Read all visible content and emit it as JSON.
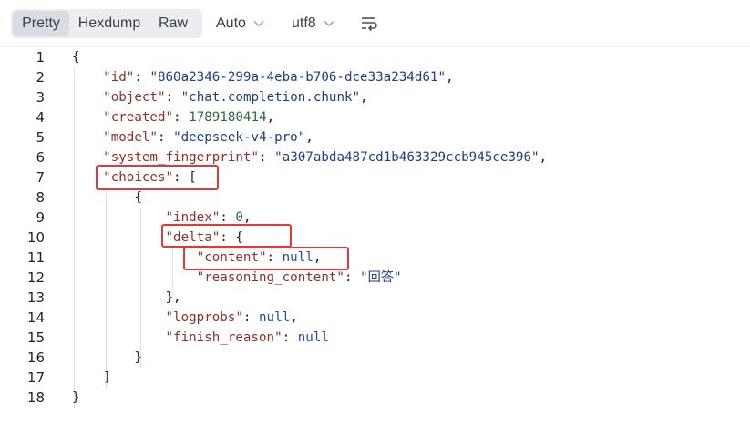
{
  "toolbar": {
    "tabs": [
      {
        "label": "Pretty",
        "active": true
      },
      {
        "label": "Hexdump",
        "active": false
      },
      {
        "label": "Raw",
        "active": false
      }
    ],
    "format_select": "Auto",
    "encoding_select": "utf8",
    "wrap_icon": "wrap-lines-icon"
  },
  "colors": {
    "key": "#8f2f27",
    "string": "#1c3f80",
    "number": "#2a6b3d",
    "keyword": "#2050a0",
    "highlight_box": "#e0383b"
  },
  "lines": [
    {
      "num": "1",
      "tokens": [
        {
          "t": "p",
          "v": "{"
        }
      ]
    },
    {
      "num": "2",
      "tokens": [
        {
          "t": "p",
          "v": "    "
        },
        {
          "t": "k",
          "v": "\"id\""
        },
        {
          "t": "p",
          "v": ": "
        },
        {
          "t": "s",
          "v": "\"860a2346-299a-4eba-b706-dce33a234d61\""
        },
        {
          "t": "p",
          "v": ","
        }
      ]
    },
    {
      "num": "3",
      "tokens": [
        {
          "t": "p",
          "v": "    "
        },
        {
          "t": "k",
          "v": "\"object\""
        },
        {
          "t": "p",
          "v": ": "
        },
        {
          "t": "s",
          "v": "\"chat.completion.chunk\""
        },
        {
          "t": "p",
          "v": ","
        }
      ]
    },
    {
      "num": "4",
      "tokens": [
        {
          "t": "p",
          "v": "    "
        },
        {
          "t": "k",
          "v": "\"created\""
        },
        {
          "t": "p",
          "v": ": "
        },
        {
          "t": "n",
          "v": "1789180414"
        },
        {
          "t": "p",
          "v": ","
        }
      ]
    },
    {
      "num": "5",
      "tokens": [
        {
          "t": "p",
          "v": "    "
        },
        {
          "t": "k",
          "v": "\"model\""
        },
        {
          "t": "p",
          "v": ": "
        },
        {
          "t": "s",
          "v": "\"deepseek-v4-pro\""
        },
        {
          "t": "p",
          "v": ","
        }
      ]
    },
    {
      "num": "6",
      "tokens": [
        {
          "t": "p",
          "v": "    "
        },
        {
          "t": "k",
          "v": "\"system_fingerprint\""
        },
        {
          "t": "p",
          "v": ": "
        },
        {
          "t": "s",
          "v": "\"a307abda487cd1b463329ccb945ce396\""
        },
        {
          "t": "p",
          "v": ","
        }
      ]
    },
    {
      "num": "7",
      "tokens": [
        {
          "t": "p",
          "v": "    "
        },
        {
          "t": "k",
          "v": "\"choices\""
        },
        {
          "t": "p",
          "v": ": ["
        }
      ]
    },
    {
      "num": "8",
      "tokens": [
        {
          "t": "p",
          "v": "        {"
        }
      ]
    },
    {
      "num": "9",
      "tokens": [
        {
          "t": "p",
          "v": "            "
        },
        {
          "t": "k",
          "v": "\"index\""
        },
        {
          "t": "p",
          "v": ": "
        },
        {
          "t": "n",
          "v": "0"
        },
        {
          "t": "p",
          "v": ","
        }
      ]
    },
    {
      "num": "10",
      "tokens": [
        {
          "t": "p",
          "v": "            "
        },
        {
          "t": "k",
          "v": "\"delta\""
        },
        {
          "t": "p",
          "v": ": {"
        }
      ]
    },
    {
      "num": "11",
      "tokens": [
        {
          "t": "p",
          "v": "                "
        },
        {
          "t": "k",
          "v": "\"content\""
        },
        {
          "t": "p",
          "v": ": "
        },
        {
          "t": "b",
          "v": "null"
        },
        {
          "t": "p",
          "v": ","
        }
      ]
    },
    {
      "num": "12",
      "tokens": [
        {
          "t": "p",
          "v": "                "
        },
        {
          "t": "k",
          "v": "\"reasoning_content\""
        },
        {
          "t": "p",
          "v": ": "
        },
        {
          "t": "s",
          "v": "\"回答\""
        }
      ]
    },
    {
      "num": "13",
      "tokens": [
        {
          "t": "p",
          "v": "            },"
        }
      ]
    },
    {
      "num": "14",
      "tokens": [
        {
          "t": "p",
          "v": "            "
        },
        {
          "t": "k",
          "v": "\"logprobs\""
        },
        {
          "t": "p",
          "v": ": "
        },
        {
          "t": "b",
          "v": "null"
        },
        {
          "t": "p",
          "v": ","
        }
      ]
    },
    {
      "num": "15",
      "tokens": [
        {
          "t": "p",
          "v": "            "
        },
        {
          "t": "k",
          "v": "\"finish_reason\""
        },
        {
          "t": "p",
          "v": ": "
        },
        {
          "t": "b",
          "v": "null"
        }
      ]
    },
    {
      "num": "16",
      "tokens": [
        {
          "t": "p",
          "v": "        }"
        }
      ]
    },
    {
      "num": "17",
      "tokens": [
        {
          "t": "p",
          "v": "    ]"
        }
      ]
    },
    {
      "num": "18",
      "tokens": [
        {
          "t": "p",
          "v": "}"
        }
      ]
    }
  ]
}
